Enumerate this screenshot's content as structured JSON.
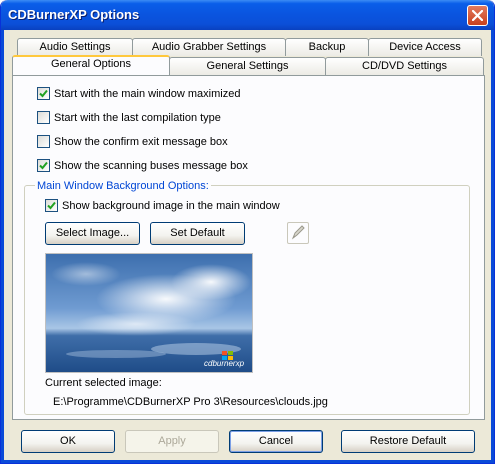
{
  "window": {
    "title": "CDBurnerXP Options"
  },
  "tabs": {
    "row1": [
      "Audio Settings",
      "Audio Grabber Settings",
      "Backup",
      "Device Access"
    ],
    "row2": [
      "General Options",
      "General Settings",
      "CD/DVD Settings"
    ],
    "active": "General Options"
  },
  "options": [
    {
      "label": "Start with the main window maximized",
      "checked": true
    },
    {
      "label": "Start with the last compilation type",
      "checked": false
    },
    {
      "label": "Show the confirm exit message box",
      "checked": false
    },
    {
      "label": "Show the scanning buses message box",
      "checked": true
    }
  ],
  "background_group": {
    "title": "Main Window Background Options:",
    "show_background": {
      "label": "Show background image in the main window",
      "checked": true
    },
    "select_image_label": "Select Image...",
    "set_default_label": "Set Default",
    "current_image_caption": "Current selected image:",
    "current_image_path": "E:\\Programme\\CDBurnerXP Pro 3\\Resources\\clouds.jpg",
    "preview_logo_text": "cdburnerxp"
  },
  "footer": {
    "ok_label": "OK",
    "apply_label": "Apply",
    "cancel_label": "Cancel",
    "restore_label": "Restore Default"
  },
  "colors": {
    "titlebar": "#0a55e0",
    "group_title": "#0046d5",
    "active_tab_accent": "#ffc83c"
  },
  "icons": [
    "close-icon",
    "check-icon",
    "pen-icon",
    "windows-logo-icon"
  ]
}
